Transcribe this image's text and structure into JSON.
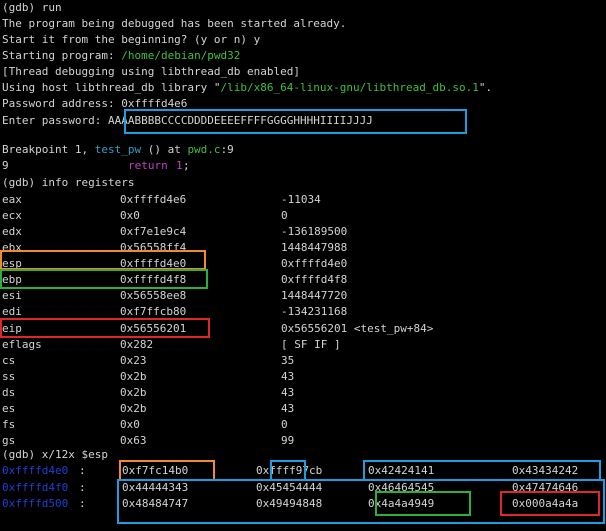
{
  "session": {
    "lines": [
      "(gdb) run",
      "The program being debugged has been started already.",
      "Start it from the beginning? (y or n) y",
      "Starting program: ",
      "[Thread debugging using libthread_db enabled]",
      "Using host libthread_db library \"",
      "Password address: 0xffffd4e6",
      "Enter password: ",
      "",
      "Breakpoint 1, ",
      "9",
      "(gdb) info registers"
    ],
    "program_path": "/home/debian/pwd32",
    "libthread_path": "/lib/x86_64-linux-gnu/libthread_db.so.1",
    "libthread_tail": "\".",
    "password_input": "AAAABBBBCCCCDDDDEEEEFFFFGGGGHHHHIIIIJJJJ",
    "bp_func": "test_pw",
    "bp_mid": " () at ",
    "bp_file": "pwd.c",
    "bp_line": ":9",
    "src_keyword": "return",
    "src_value": "1",
    "src_semicolon": ";"
  },
  "registers": [
    {
      "name": "eax",
      "hex": "0xffffd4e6",
      "natural": "-11034"
    },
    {
      "name": "ecx",
      "hex": "0x0",
      "natural": "0"
    },
    {
      "name": "edx",
      "hex": "0xf7e1e9c4",
      "natural": "-136189500"
    },
    {
      "name": "ebx",
      "hex": "0x56558ff4",
      "natural": "1448447988"
    },
    {
      "name": "esp",
      "hex": "0xffffd4e0",
      "natural": "0xffffd4e0"
    },
    {
      "name": "ebp",
      "hex": "0xffffd4f8",
      "natural": "0xffffd4f8"
    },
    {
      "name": "esi",
      "hex": "0x56558ee8",
      "natural": "1448447720"
    },
    {
      "name": "edi",
      "hex": "0xf7ffcb80",
      "natural": "-134231168"
    },
    {
      "name": "eip",
      "hex": "0x56556201",
      "natural": "0x56556201 <test_pw+84>"
    },
    {
      "name": "eflags",
      "hex": "0x282",
      "natural": "[ SF IF ]"
    },
    {
      "name": "cs",
      "hex": "0x23",
      "natural": "35"
    },
    {
      "name": "ss",
      "hex": "0x2b",
      "natural": "43"
    },
    {
      "name": "ds",
      "hex": "0x2b",
      "natural": "43"
    },
    {
      "name": "es",
      "hex": "0x2b",
      "natural": "43"
    },
    {
      "name": "fs",
      "hex": "0x0",
      "natural": "0"
    },
    {
      "name": "gs",
      "hex": "0x63",
      "natural": "99"
    }
  ],
  "examine": {
    "command": "(gdb) x/12x $esp",
    "rows": [
      {
        "addr": "0xffffd4e0",
        "sep": ":",
        "words": [
          "0xf7fc14b0",
          "0xffff97cb",
          "0x42424141",
          "0x43434242"
        ]
      },
      {
        "addr": "0xffffd4f0",
        "sep": ":",
        "words": [
          "0x44444343",
          "0x45454444",
          "0x46464545",
          "0x47474646"
        ]
      },
      {
        "addr": "0xffffd500",
        "sep": ":",
        "words": [
          "0x48484747",
          "0x49494848",
          "0x4a4a4949",
          "0x000a4a4a"
        ]
      }
    ]
  },
  "colors": {
    "background": "#000000",
    "text": "#d3d3d3",
    "path_green": "#3fbf3f",
    "keyword_magenta": "#c040c0",
    "func_cyan": "#2fa0c8",
    "address_blue": "#1d3fd6",
    "box_blue": "#1e9ce0",
    "box_orange": "#f08a2a",
    "box_green": "#2fae3e",
    "box_red": "#e0262a"
  }
}
